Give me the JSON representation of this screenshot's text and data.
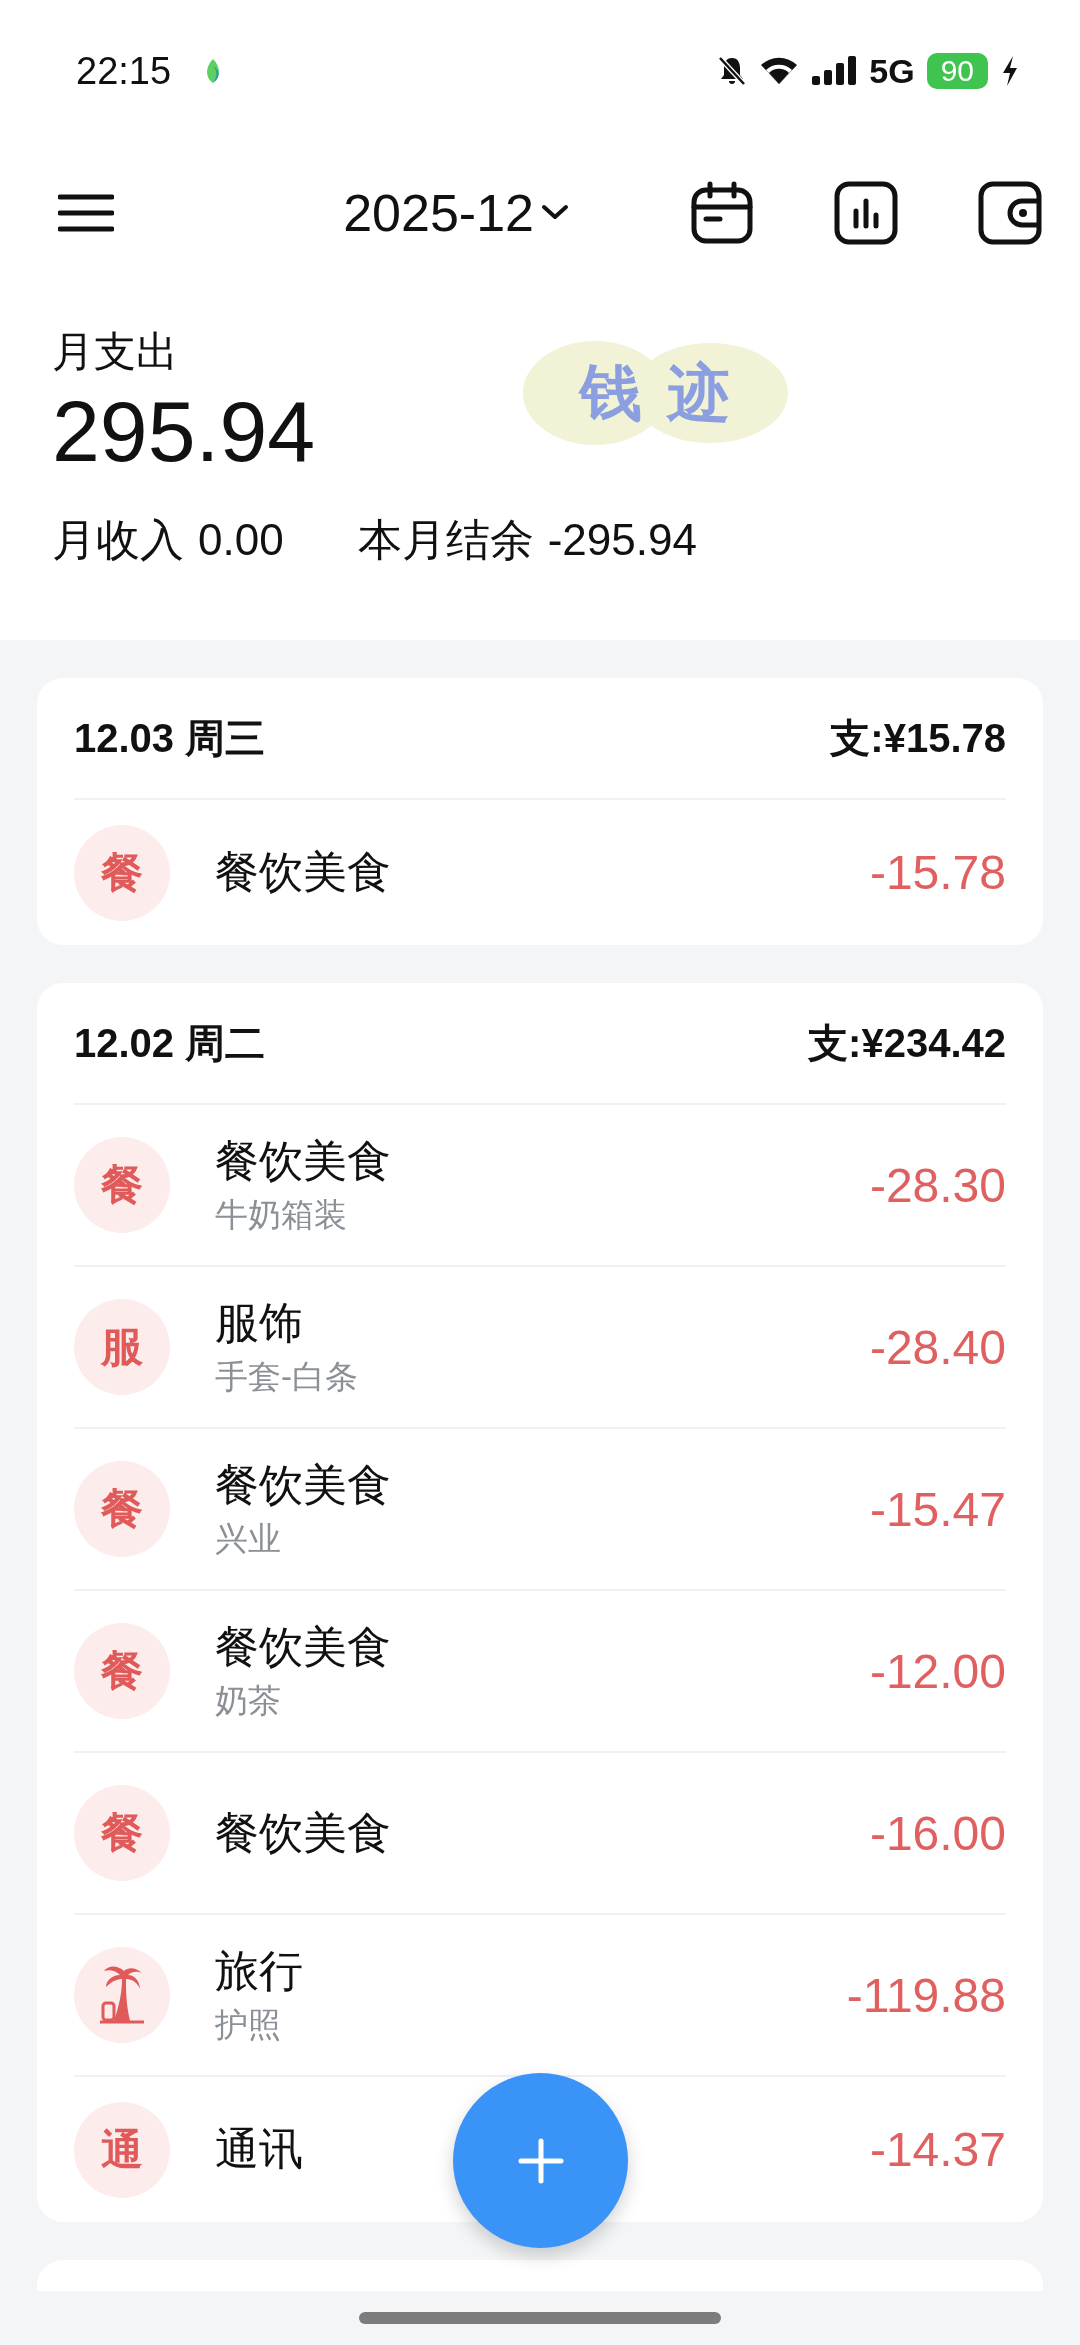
{
  "status_bar": {
    "time": "22:15",
    "network": "5G",
    "battery": "90"
  },
  "header": {
    "month": "2025-12"
  },
  "summary": {
    "expense_label": "月支出",
    "expense": "295.94",
    "logo": "钱迹",
    "income_label": "月收入",
    "income": "0.00",
    "balance_label": "本月结余",
    "balance": "-295.94"
  },
  "days": [
    {
      "date": "12.03 周三",
      "total": "支:¥15.78",
      "items": [
        {
          "kind": "text",
          "icon": "餐",
          "category": "餐饮美食",
          "amount": "-15.78"
        }
      ]
    },
    {
      "date": "12.02 周二",
      "total": "支:¥234.42",
      "items": [
        {
          "kind": "text",
          "icon": "餐",
          "category": "餐饮美食",
          "note": "牛奶箱装",
          "amount": "-28.30"
        },
        {
          "kind": "text",
          "icon": "服",
          "category": "服饰",
          "note": "手套-白条",
          "amount": "-28.40"
        },
        {
          "kind": "text",
          "icon": "餐",
          "category": "餐饮美食",
          "note": "兴业",
          "amount": "-15.47"
        },
        {
          "kind": "text",
          "icon": "餐",
          "category": "餐饮美食",
          "note": "奶茶",
          "amount": "-12.00"
        },
        {
          "kind": "text",
          "icon": "餐",
          "category": "餐饮美食",
          "amount": "-16.00"
        },
        {
          "kind": "palm",
          "category": "旅行",
          "note": "护照",
          "amount": "-119.88"
        },
        {
          "kind": "text",
          "icon": "通",
          "category": "通讯",
          "amount": "-14.37"
        }
      ]
    }
  ]
}
